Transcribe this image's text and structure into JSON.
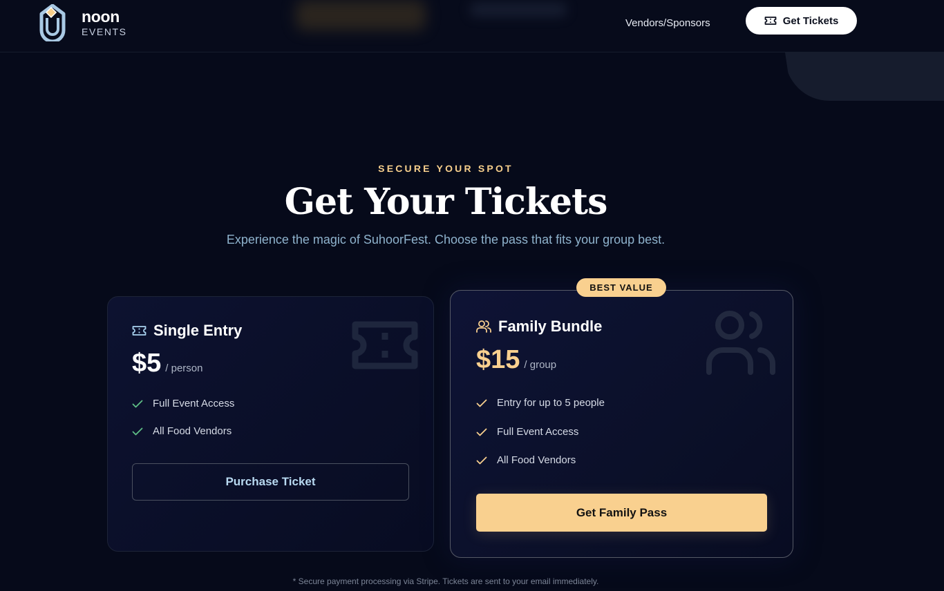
{
  "brand": {
    "name": "noon",
    "sub": "EVENTS"
  },
  "nav": {
    "vendors": "Vendors/Sponsors",
    "cta": "Get Tickets"
  },
  "section": {
    "eyebrow": "SECURE YOUR SPOT",
    "title": "Get Your Tickets",
    "subtitle": "Experience the magic of SuhoorFest. Choose the pass that fits your group best."
  },
  "cards": [
    {
      "name": "Single Entry",
      "price": "$5",
      "unit": "/ person",
      "features": [
        "Full Event Access",
        "All Food Vendors"
      ],
      "button": "Purchase Ticket",
      "icon": "ticket-icon"
    },
    {
      "name": "Family Bundle",
      "badge": "BEST VALUE",
      "price": "$15",
      "unit": "/ group",
      "features": [
        "Entry for up to 5 people",
        "Full Event Access",
        "All Food Vendors"
      ],
      "button": "Get Family Pass",
      "icon": "users-icon"
    }
  ],
  "footnote": "* Secure payment processing via Stripe. Tickets are sent to your email immediately.",
  "colors": {
    "accent": "#f9d08f",
    "check_single": "#5fbf86",
    "background": "#060a1a",
    "subtitle": "#8fb3cd"
  }
}
